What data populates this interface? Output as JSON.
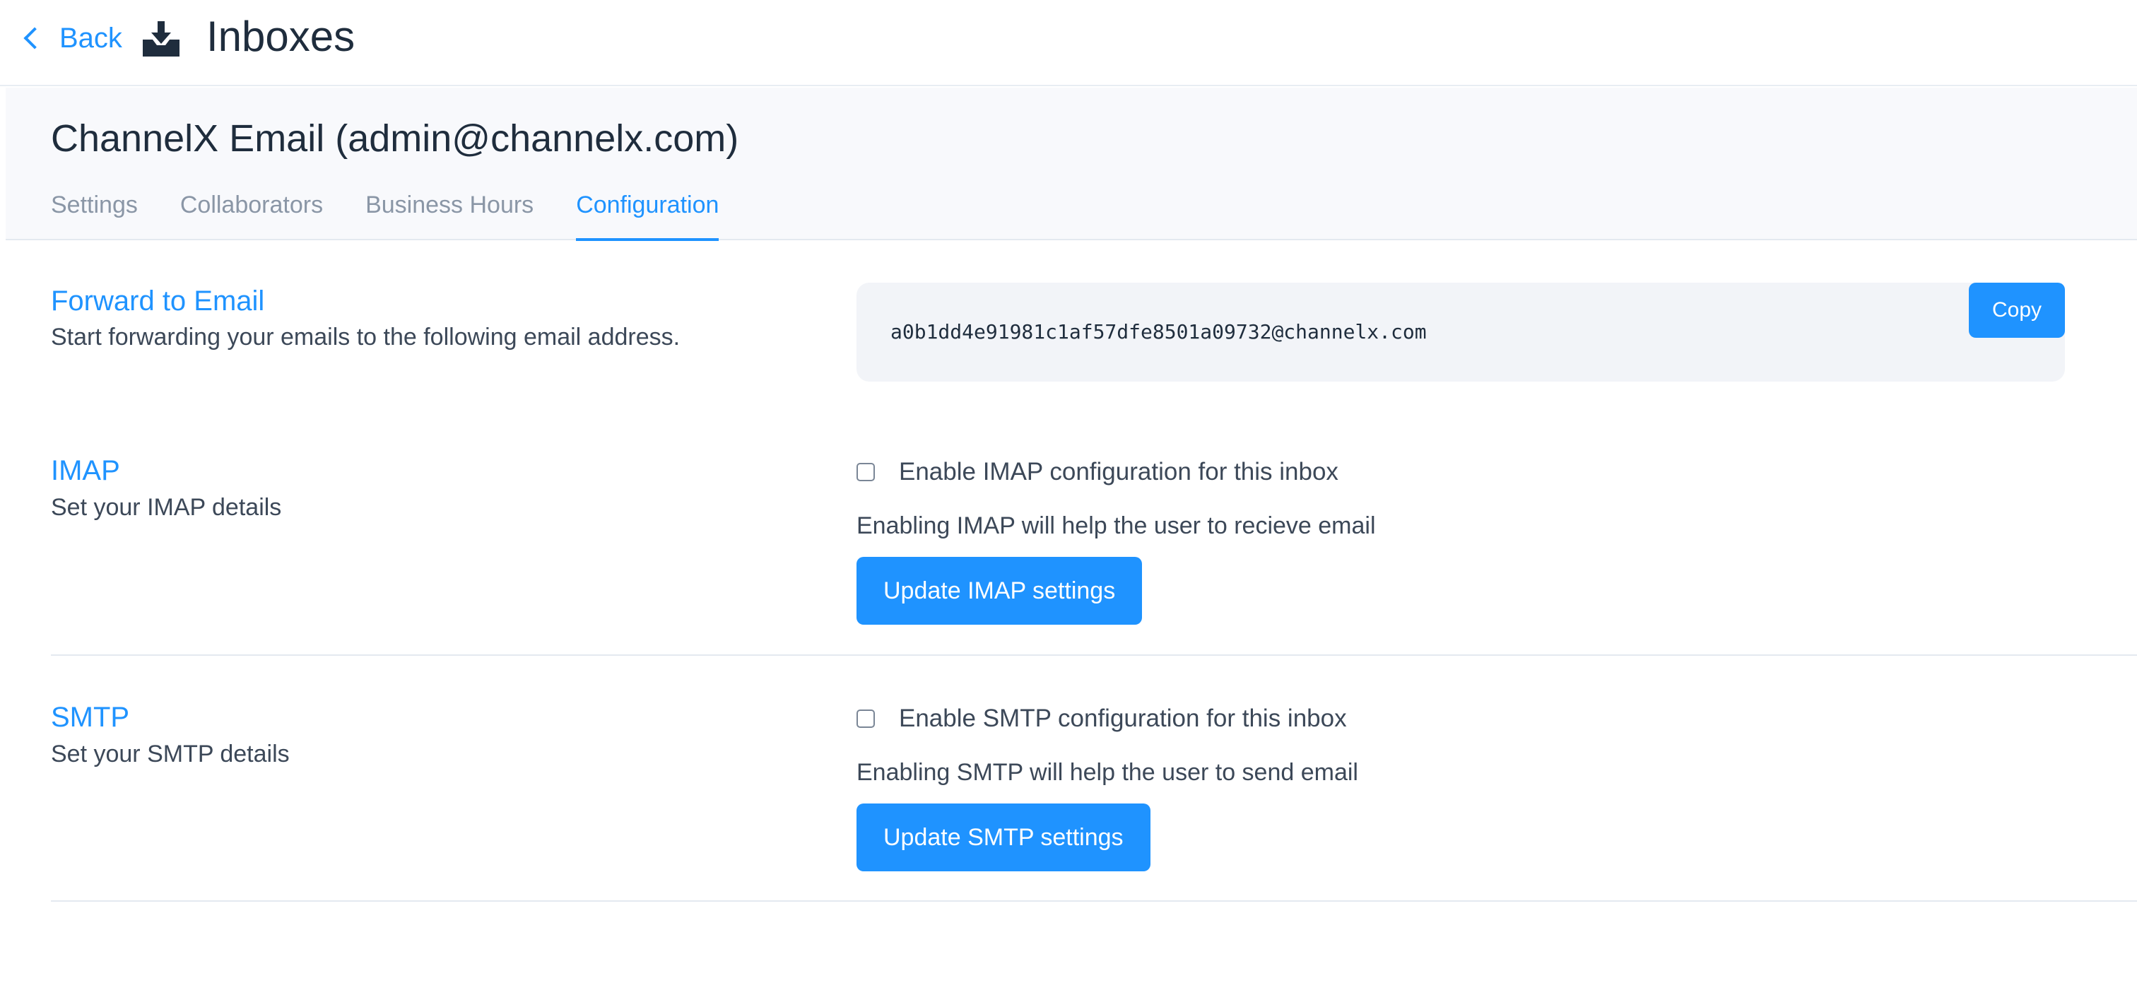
{
  "header": {
    "back_label": "Back",
    "title": "Inboxes",
    "icon": "inbox-download-icon"
  },
  "inbox": {
    "title": "ChannelX Email (admin@channelx.com)",
    "tabs": [
      {
        "label": "Settings",
        "active": false
      },
      {
        "label": "Collaborators",
        "active": false
      },
      {
        "label": "Business Hours",
        "active": false
      },
      {
        "label": "Configuration",
        "active": true
      }
    ]
  },
  "forward": {
    "title": "Forward to Email",
    "description": "Start forwarding your emails to the following email address.",
    "email": "a0b1dd4e91981c1af57dfe8501a09732@channelx.com",
    "copy_label": "Copy"
  },
  "imap": {
    "title": "IMAP",
    "description": "Set your IMAP details",
    "checkbox_label": "Enable IMAP configuration for this inbox",
    "checked": false,
    "help": "Enabling IMAP will help the user to recieve email",
    "button_label": "Update IMAP settings"
  },
  "smtp": {
    "title": "SMTP",
    "description": "Set your SMTP details",
    "checkbox_label": "Enable SMTP configuration for this inbox",
    "checked": false,
    "help": "Enabling SMTP will help the user to send email",
    "button_label": "Update SMTP settings"
  },
  "colors": {
    "accent": "#1f93ff",
    "text": "#1f2d3d",
    "muted": "#8a96a6",
    "subheader_bg": "#f8f9fc"
  }
}
